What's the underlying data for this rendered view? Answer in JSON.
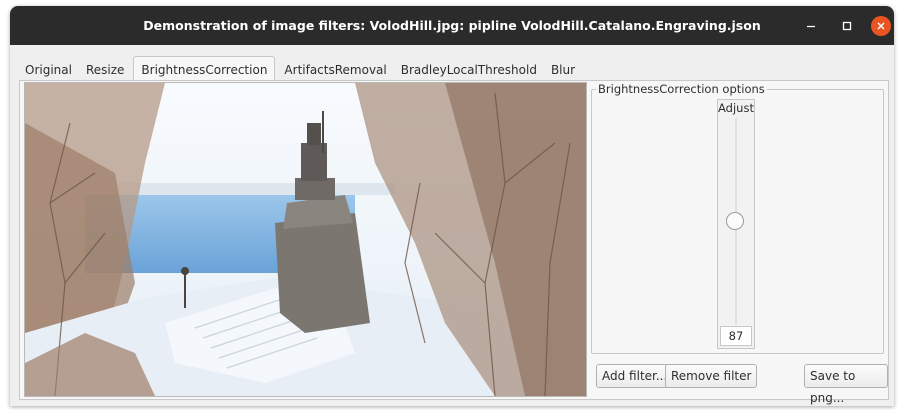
{
  "window": {
    "title": "Demonstration of image filters: VolodHill.jpg: pipline VolodHill.Catalano.Engraving.json",
    "controls": {
      "minimize_icon": "minimize-icon",
      "maximize_icon": "maximize-icon",
      "close_icon": "close-icon",
      "close_color": "#e95420"
    }
  },
  "tabs": [
    {
      "label": "Original",
      "active": false
    },
    {
      "label": "Resize",
      "active": false
    },
    {
      "label": "BrightnessCorrection",
      "active": true
    },
    {
      "label": "ArtifactsRemoval",
      "active": false
    },
    {
      "label": "BradleyLocalThreshold",
      "active": false
    },
    {
      "label": "Blur",
      "active": false
    }
  ],
  "options": {
    "group_title": "BrightnessCorrection options",
    "adjust": {
      "label": "Adjust",
      "value": "87",
      "slider_level": 0.5
    }
  },
  "buttons": {
    "add_filter": "Add filter...",
    "remove_filter": "Remove filter",
    "save_png": "Save to png..."
  },
  "image": {
    "description": "preview-image",
    "palette": {
      "sky": "#eef3f8",
      "water": "#7fb2e0",
      "snow": "#e6edf4",
      "monument": "#7e7872",
      "trees": "#8a6f5e"
    }
  }
}
